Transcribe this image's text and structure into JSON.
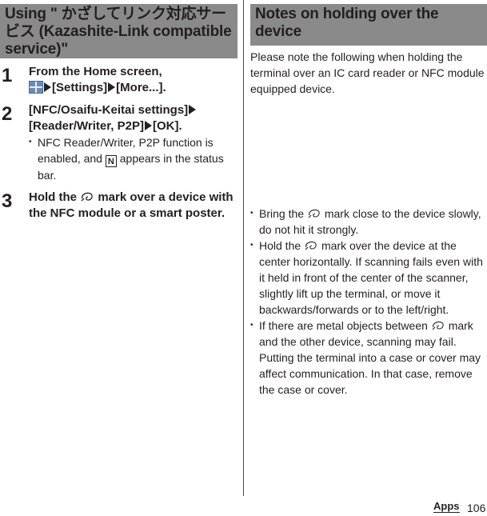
{
  "left": {
    "header": "Using \" かざしてリンク対応サービス (Kazashite-Link compatible service)\"",
    "steps": [
      {
        "num": "1",
        "line1": "From the Home screen,",
        "icon": "apps-grid-icon",
        "items": [
          "[Settings]",
          "[More...]."
        ]
      },
      {
        "num": "2",
        "line1": "[NFC/Osaifu-Keitai settings]",
        "line2a": "[Reader/Writer, P2P]",
        "line2b": "[OK].",
        "note_before": "NFC Reader/Writer, P2P function is enabled, and",
        "note_icon": "N",
        "note_after": "appears in the status bar."
      },
      {
        "num": "3",
        "text_before": "Hold the",
        "icon": "felica-mark-icon",
        "text_after": "mark over a device with the NFC module or a smart poster."
      }
    ]
  },
  "right": {
    "header": "Notes on holding over the device",
    "intro": "Please note the following when holding the terminal over an IC card reader or NFC module equipped device.",
    "bullets": [
      {
        "before": "Bring the",
        "after": "mark close to the device slowly, do not hit it strongly."
      },
      {
        "before": "Hold the",
        "after": "mark over the device at the center horizontally. If scanning fails even with it held in front of the center of the scanner, slightly lift up the terminal, or move it backwards/forwards or to the left/right."
      },
      {
        "before": "If there are metal objects between",
        "after": "mark and the other device, scanning may fail. Putting the terminal into a case or cover may affect communication. In that case, remove the case or cover."
      }
    ]
  },
  "footer": {
    "section": "Apps",
    "page": "106"
  },
  "colors": {
    "header_bg": "#8a8a8a",
    "text": "#231f20",
    "apps_icon": "#6b8bb5"
  }
}
